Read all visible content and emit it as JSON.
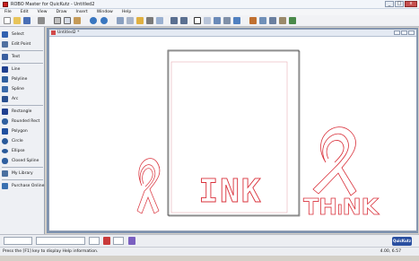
{
  "app": {
    "title": "ROBO Master for QuicKutz - Untitled2"
  },
  "window_buttons": {
    "minimize": "_",
    "maximize": "□",
    "close": "x"
  },
  "menu": [
    "File",
    "Edit",
    "View",
    "Draw",
    "Insert",
    "Window",
    "Help"
  ],
  "toolbar": {
    "buttons": [
      "new",
      "open",
      "save",
      "print",
      "cut",
      "copy",
      "paste",
      "undo",
      "redo",
      "select",
      "node-edit",
      "zoom-in",
      "zoom-out",
      "zoom-fit",
      "group",
      "ungroup",
      "weld",
      "mirror",
      "rotate",
      "align",
      "cut-send"
    ]
  },
  "sidebar": {
    "items": [
      {
        "label": "Select",
        "icon": "arrow-select-icon"
      },
      {
        "label": "Edit Point",
        "icon": "edit-point-icon"
      },
      {
        "label": "Text",
        "icon": "text-icon"
      },
      {
        "label": "Line",
        "icon": "line-icon"
      },
      {
        "label": "Polyline",
        "icon": "polyline-icon"
      },
      {
        "label": "Spline",
        "icon": "spline-icon"
      },
      {
        "label": "Arc",
        "icon": "arc-icon"
      },
      {
        "label": "Rectangle",
        "icon": "rectangle-icon"
      },
      {
        "label": "Rounded Rect",
        "icon": "rounded-rect-icon"
      },
      {
        "label": "Polygon",
        "icon": "polygon-icon"
      },
      {
        "label": "Circle",
        "icon": "circle-icon"
      },
      {
        "label": "Ellipse",
        "icon": "ellipse-icon"
      },
      {
        "label": "Closed Spline",
        "icon": "closed-spline-icon"
      },
      {
        "label": "My Library",
        "icon": "library-icon"
      },
      {
        "label": "Purchase Online",
        "icon": "purchase-icon"
      }
    ]
  },
  "document": {
    "title": "Untitled2 *",
    "word_ink": "INK",
    "word_think_prefix": "TH",
    "word_think_mid": "I",
    "word_think_suffix": "NK"
  },
  "colors": {
    "cut_line": "#d9303a",
    "canvas_bg": "#ffffff",
    "mdi_bg": "#7e93b0"
  },
  "status": {
    "help_text": "Press the [F1] key to display Help information.",
    "coordinates": "4.00, 6.57",
    "logo_text": "QuicKutz"
  }
}
